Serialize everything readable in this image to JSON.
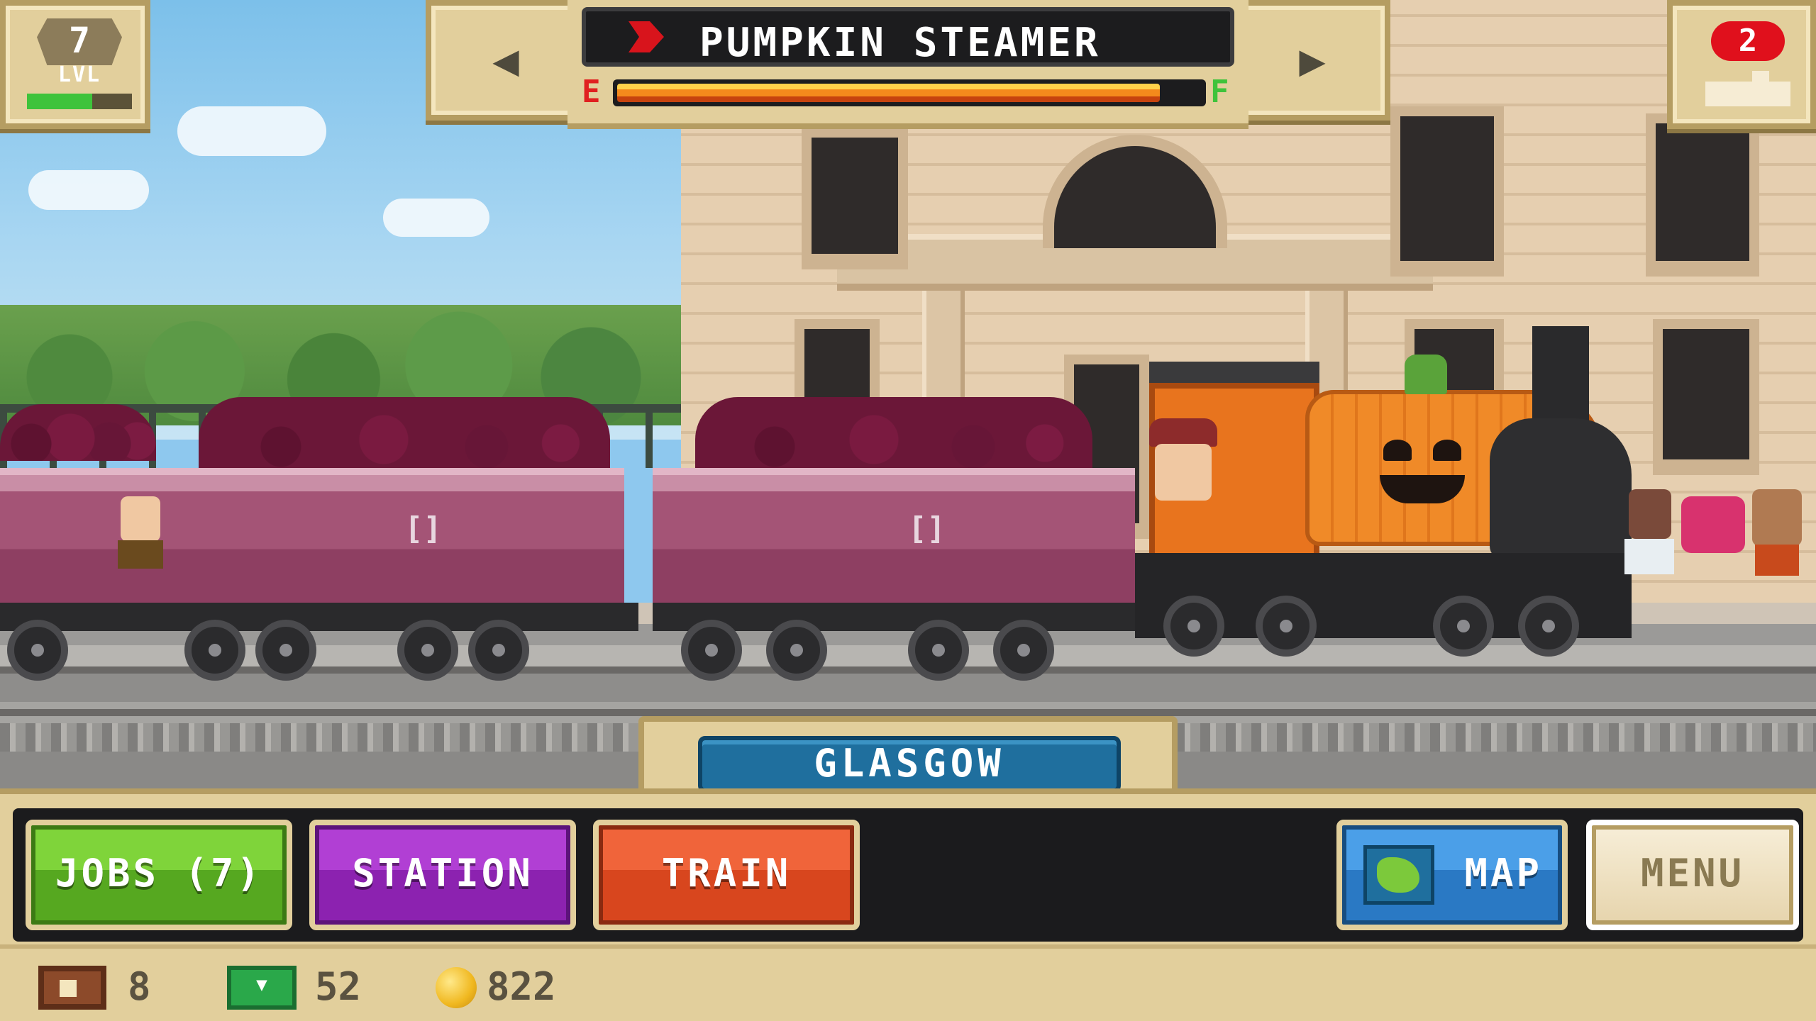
{
  "hud": {
    "level": {
      "number": "7",
      "label": "LVL",
      "xp_progress": 0.62
    },
    "train": {
      "name": "PUMPKIN STEAMER",
      "fuel_empty_label": "E",
      "fuel_full_label": "F",
      "fuel_level": 0.93
    },
    "nav": {
      "prev_symbol": "◀",
      "next_symbol": "▶"
    },
    "trains_badge": {
      "count": "2"
    }
  },
  "location": {
    "name": "GLASGOW"
  },
  "buttons": {
    "jobs": "JOBS (7)",
    "station": "STATION",
    "train": "TRAIN",
    "map": "MAP",
    "menu": "MENU"
  },
  "resources": {
    "crates": "8",
    "cash": "52",
    "coins": "822"
  },
  "wagon_mark": "[]",
  "colors": {
    "jobs": "#56a820",
    "station": "#8c22b0",
    "train": "#d8461e",
    "map": "#2a79c4",
    "location_plate": "#1f6f9e",
    "badge_red": "#e0101c",
    "xp_green": "#3fc33b"
  },
  "icons": {
    "title": "red-chevron-icon",
    "trains": "mini-train-icon",
    "map": "map-icon",
    "crates": "crate-icon",
    "cash": "cash-icon",
    "coins": "coin-icon"
  }
}
